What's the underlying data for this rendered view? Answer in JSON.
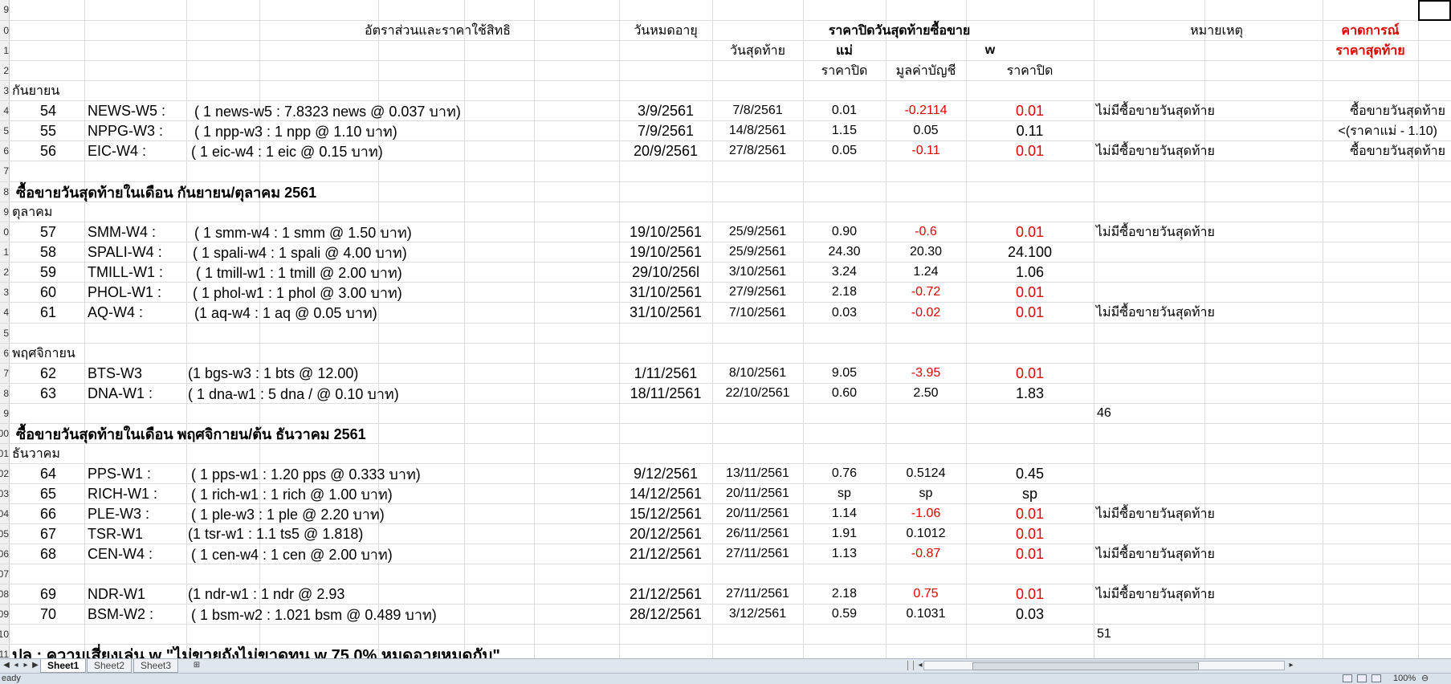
{
  "row_number_partials": [
    "9",
    "0",
    "1",
    "2",
    "3",
    "4",
    "5",
    "6",
    "7",
    "8",
    "9",
    "0",
    "1",
    "2",
    "3",
    "4",
    "5",
    "6",
    "7",
    "8",
    "9",
    "00",
    "01",
    "02",
    "03",
    "04",
    "05",
    "06",
    "07",
    "08",
    "09",
    "10",
    "11"
  ],
  "headers": {
    "ratio": "อัตราส่วนและราคาใช้สิทธิ",
    "expiry": "วันหมดอายุ",
    "last_close": "ราคาปิดวันสุดท้ายซื้อขาย",
    "note": "หมายเหตุ",
    "forecast_1": "คาดการณ์",
    "last_day": "วันสุดท้าย",
    "mother": "แม่",
    "w": "w",
    "forecast_2": "ราคาสุดท้าย",
    "close_price_1": "ราคาปิด",
    "book_value": "มูลค่าบัญชี",
    "close_price_2": "ราคาปิด"
  },
  "sections": {
    "september": "กันยายน",
    "sep_oct_title": "ซื้อขายวันสุดท้ายในเดือน กันยายน/ตุลาคม 2561",
    "october": "ตุลาคม",
    "november": "พฤศจิกายน",
    "nov_dec_title": "ซื้อขายวันสุดท้ายในเดือน พฤศจิกายน/ต้น ธันวาคม 2561",
    "december": "ธันวาคม",
    "bottom_partial": "ปล : ความเสี่ยงเล่น w  \"ไม่ขายถังไม่ขาดทุน  w 75.0% หมดอายุหมดกับ\""
  },
  "counts": {
    "oct": "46",
    "dec": "51"
  },
  "rows": [
    {
      "no": "54",
      "name": "NEWS-W5 :",
      "ratio": "( 1 news-w5  : 7.8323 news  @ 0.037 บาท)",
      "expiry": "3/9/2561",
      "last": "7/8/2561",
      "mother": "0.01",
      "book": "-0.2114",
      "book_red": true,
      "wclose": "0.01",
      "w_red": true,
      "note": "ไม่มีซื้อขายวันสุดท้าย",
      "forecast": "ซื้อขายวันสุดท้าย"
    },
    {
      "no": "55",
      "name": "NPPG-W3 :",
      "ratio": "( 1 npp-w3 : 1 npp  @ 1.10 บาท)",
      "expiry": "7/9/2561",
      "last": "14/8/2561",
      "mother": "1.15",
      "book": "0.05",
      "book_red": false,
      "wclose": "0.11",
      "w_red": false,
      "note": "",
      "forecast": "<(ราคาแม่   - 1.10)"
    },
    {
      "no": "56",
      "name": "EIC-W4 :",
      "ratio": "( 1 eic-w4 : 1 eic @ 0.15 บาท)",
      "expiry": "20/9/2561",
      "last": "27/8/2561",
      "mother": "0.05",
      "book": "-0.11",
      "book_red": true,
      "wclose": "0.01",
      "w_red": true,
      "note": "ไม่มีซื้อขายวันสุดท้าย",
      "forecast": "ซื้อขายวันสุดท้าย"
    },
    {
      "no": "57",
      "name": "SMM-W4 :",
      "ratio": "( 1 smm-w4 : 1 smm  @ 1.50 บาท)",
      "expiry": "19/10/2561",
      "last": "25/9/2561",
      "mother": "0.90",
      "book": "-0.6",
      "book_red": true,
      "wclose": "0.01",
      "w_red": true,
      "note": "ไม่มีซื้อขายวันสุดท้าย",
      "forecast": ""
    },
    {
      "no": "58",
      "name": "SPALI-W4 :",
      "ratio": "( 1 spali-w4 : 1 spali  @ 4.00 บาท)",
      "expiry": "19/10/2561",
      "last": "25/9/2561",
      "mother": "24.30",
      "book": "20.30",
      "book_red": false,
      "wclose": "24.100",
      "w_red": false,
      "note": "",
      "forecast": ""
    },
    {
      "no": "59",
      "name": "TMILL-W1 :",
      "ratio": "( 1 tmill-w1 : 1 tmill  @ 2.00 บาท)",
      "expiry": "29/10/256l",
      "last": "3/10/2561",
      "mother": "3.24",
      "book": "1.24",
      "book_red": false,
      "wclose": "1.06",
      "w_red": false,
      "note": "",
      "forecast": ""
    },
    {
      "no": "60",
      "name": "PHOL-W1 :",
      "ratio": "( 1 phol-w1 : 1 phol  @ 3.00 บาท)",
      "expiry": "31/10/2561",
      "last": "27/9/2561",
      "mother": "2.18",
      "book": "-0.72",
      "book_red": true,
      "wclose": "0.01",
      "w_red": true,
      "note": "",
      "forecast": ""
    },
    {
      "no": "61",
      "name": "AQ-W4 :",
      "ratio": "(1 aq-w4 : 1 aq @ 0.05 บาท)",
      "expiry": "31/10/2561",
      "last": "7/10/2561",
      "mother": "0.03",
      "book": "-0.02",
      "book_red": true,
      "wclose": "0.01",
      "w_red": true,
      "note": "ไม่มีซื้อขายวันสุดท้าย",
      "forecast": ""
    },
    {
      "no": "62",
      "name": "BTS-W3",
      "ratio": "(1 bgs-w3 : 1 bts @ 12.00)",
      "expiry": "1/11/2561",
      "last": "8/10/2561",
      "mother": "9.05",
      "book": "-3.95",
      "book_red": true,
      "wclose": "0.01",
      "w_red": true,
      "note": "",
      "forecast": ""
    },
    {
      "no": "63",
      "name": "DNA-W1 :",
      "ratio": "( 1 dna-w1 : 5 dna / @ 0.10 บาท)",
      "expiry": "18/11/2561",
      "last": "22/10/2561",
      "mother": "0.60",
      "book": "2.50",
      "book_red": false,
      "wclose": "1.83",
      "w_red": false,
      "note": "",
      "forecast": ""
    },
    {
      "no": "64",
      "name": "PPS-W1 :",
      "ratio": "( 1 pps-w1 : 1.20 pps  @ 0.333 บาท)",
      "expiry": "9/12/2561",
      "last": "13/11/2561",
      "mother": "0.76",
      "book": "0.5124",
      "book_red": false,
      "wclose": "0.45",
      "w_red": false,
      "note": "",
      "forecast": ""
    },
    {
      "no": "65",
      "name": "RICH-W1 :",
      "ratio": "( 1 rich-w1 : 1 rich  @ 1.00 บาท)",
      "expiry": "14/12/2561",
      "last": "20/11/2561",
      "mother": "sp",
      "book": "sp",
      "book_red": false,
      "wclose": "sp",
      "w_red": false,
      "note": "",
      "forecast": ""
    },
    {
      "no": "66",
      "name": "PLE-W3 :",
      "ratio": "( 1 ple-w3 : 1 ple  @ 2.20 บาท)",
      "expiry": "15/12/2561",
      "last": "20/11/2561",
      "mother": "1.14",
      "book": "-1.06",
      "book_red": true,
      "wclose": "0.01",
      "w_red": true,
      "note": "ไม่มีซื้อขายวันสุดท้าย",
      "forecast": ""
    },
    {
      "no": "67",
      "name": "TSR-W1",
      "ratio": "(1 tsr-w1 : 1.1 ts5 @ 1.818)",
      "expiry": "20/12/2561",
      "last": "26/11/2561",
      "mother": "1.91",
      "book": "0.1012",
      "book_red": false,
      "wclose": "0.01",
      "w_red": true,
      "note": "",
      "forecast": ""
    },
    {
      "no": "68",
      "name": "CEN-W4 :",
      "ratio": "( 1 cen-w4 : 1 cen  @ 2.00 บาท)",
      "expiry": "21/12/2561",
      "last": "27/11/2561",
      "mother": "1.13",
      "book": "-0.87",
      "book_red": true,
      "wclose": "0.01",
      "w_red": true,
      "note": "ไม่มีซื้อขายวันสุดท้าย",
      "forecast": ""
    },
    {
      "no": "69",
      "name": "NDR-W1",
      "ratio": "(1 ndr-w1 : 1 ndr @ 2.93",
      "expiry": "21/12/2561",
      "last": "27/11/2561",
      "mother": "2.18",
      "book": "0.75",
      "book_red": true,
      "wclose": "0.01",
      "w_red": true,
      "note": "ไม่มีซื้อขายวันสุดท้าย",
      "forecast": ""
    },
    {
      "no": "70",
      "name": "BSM-W2 :",
      "ratio": "( 1 bsm-w2 : 1.021 bsm  @ 0.489 บาท)",
      "expiry": "28/12/2561",
      "last": "3/12/2561",
      "mother": "0.59",
      "book": "0.1031",
      "book_red": false,
      "wclose": "0.03",
      "w_red": false,
      "note": "",
      "forecast": ""
    }
  ],
  "tabs": [
    "Sheet1",
    "Sheet2",
    "Sheet3"
  ],
  "status": {
    "ready": "eady",
    "zoom": "100%"
  },
  "colors": {
    "red": "#e00000",
    "grid": "#dadcdd",
    "tabbar": "#dfe6ee"
  }
}
